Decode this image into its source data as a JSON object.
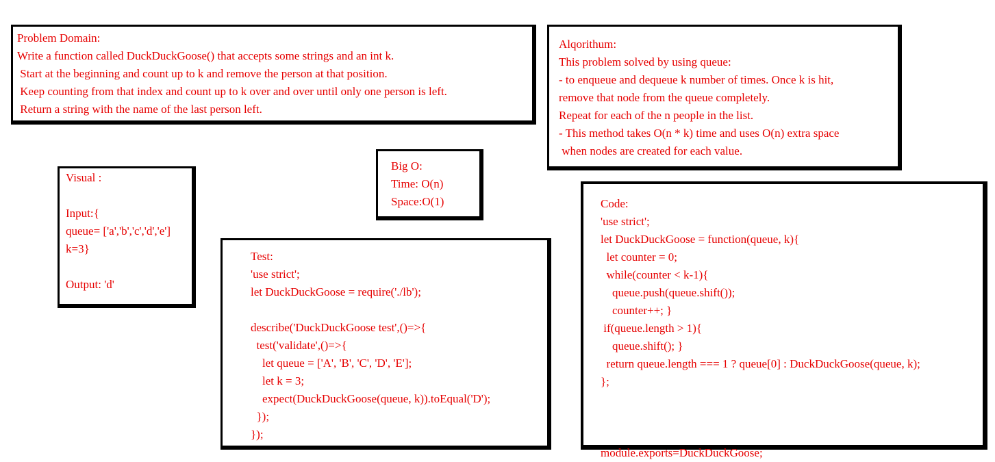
{
  "problem_domain": {
    "title": "Problem Domain:",
    "lines": [
      "Write a function called DuckDuckGoose() that accepts some strings and an int k.",
      " Start at the beginning and count up to k and remove the person at that position.",
      " Keep counting from that index and count up to k over and over until only one person is left.",
      " Return a string with the name of the last person left."
    ]
  },
  "algorithm": {
    "title": "Alqorithum:",
    "lines": [
      "This problem solved by using queue:",
      "- to enqueue and dequeue k number of times. Once k is hit,",
      "remove that node from the queue completely.",
      "Repeat for each of the n people in the list.",
      "- This method takes O(n * k) time and uses O(n) extra space",
      " when nodes are created for each value."
    ]
  },
  "big_o": {
    "title": "Big O:",
    "time": "Time: O(n)",
    "space": "Space:O(1)"
  },
  "visual": {
    "title": "Visual :",
    "input_label": "Input:{",
    "queue_line": "queue= ['a','b','c','d','e']",
    "k_line": "k=3}",
    "output_line": "Output: 'd'"
  },
  "test": {
    "title": "Test:",
    "lines": [
      "'use strict';",
      "let DuckDuckGoose = require('./lb');",
      "",
      "describe('DuckDuckGoose test',()=>{",
      "  test('validate',()=>{",
      "    let queue = ['A', 'B', 'C', 'D', 'E'];",
      "    let k = 3;",
      "    expect(DuckDuckGoose(queue, k)).toEqual('D');",
      "  });",
      "});"
    ]
  },
  "code": {
    "title": "Code:",
    "lines": [
      "'use strict';",
      "let DuckDuckGoose = function(queue, k){",
      "  let counter = 0;",
      "  while(counter < k-1){",
      "    queue.push(queue.shift());",
      "    counter++; }",
      " if(queue.length > 1){",
      "    queue.shift(); }",
      "  return queue.length === 1 ? queue[0] : DuckDuckGoose(queue, k);",
      "};",
      "",
      "",
      "",
      "module.exports=DuckDuckGoose;"
    ]
  }
}
